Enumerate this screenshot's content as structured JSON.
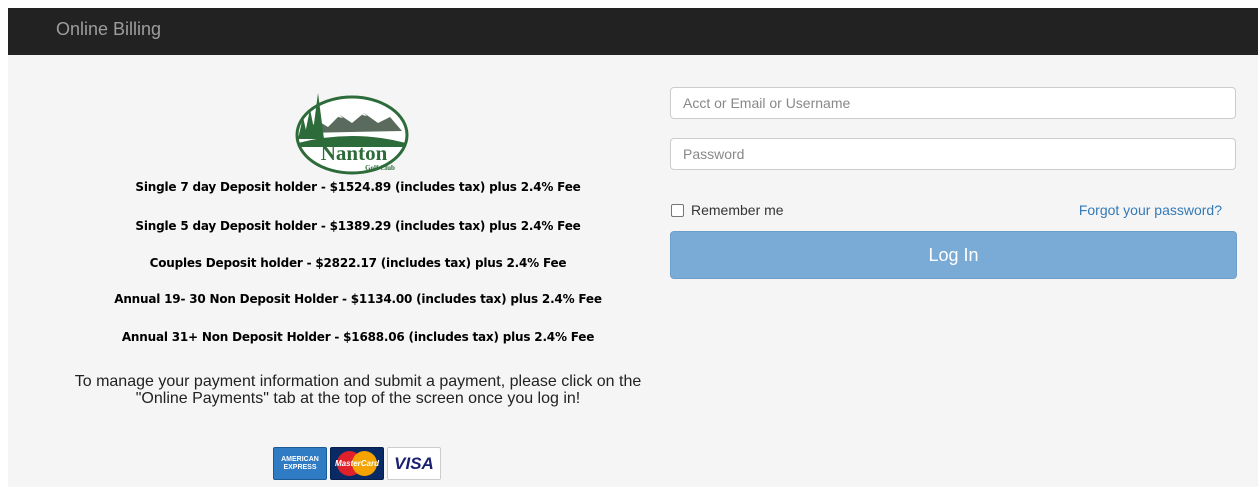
{
  "navbar": {
    "brand": "Online Billing",
    "background_color": "#222222",
    "brand_color": "#9d9d9d"
  },
  "logo": {
    "name_text": "Nanton",
    "subtitle_text": "Golf Club",
    "color": "#2e6b3a"
  },
  "fees": [
    "Single 7 day Deposit holder - $1524.89 (includes tax) plus 2.4% Fee",
    "Single 5 day Deposit holder - $1389.29 (includes tax) plus 2.4% Fee",
    "Couples Deposit holder - $2822.17 (includes tax) plus 2.4% Fee",
    "Annual 19- 30 Non Deposit Holder - $1134.00 (includes tax) plus 2.4% Fee",
    "Annual 31+ Non Deposit Holder - $1688.06 (includes tax) plus 2.4% Fee"
  ],
  "instructions": "To manage your payment information and submit a payment, please click on the \"Online Payments\" tab at the top of the screen once you log in!",
  "cards": {
    "amex_line1": "AMERICAN",
    "amex_line2": "EXPRESS",
    "mastercard": "MasterCard",
    "visa": "VISA"
  },
  "login": {
    "username_placeholder": "Acct or Email or Username",
    "username_value": "",
    "password_placeholder": "Password",
    "password_value": "",
    "remember_label": "Remember me",
    "remember_checked": false,
    "forgot_link": "Forgot your password?",
    "login_button": "Log In",
    "button_color": "#7aaad6",
    "link_color": "#337ab7"
  }
}
